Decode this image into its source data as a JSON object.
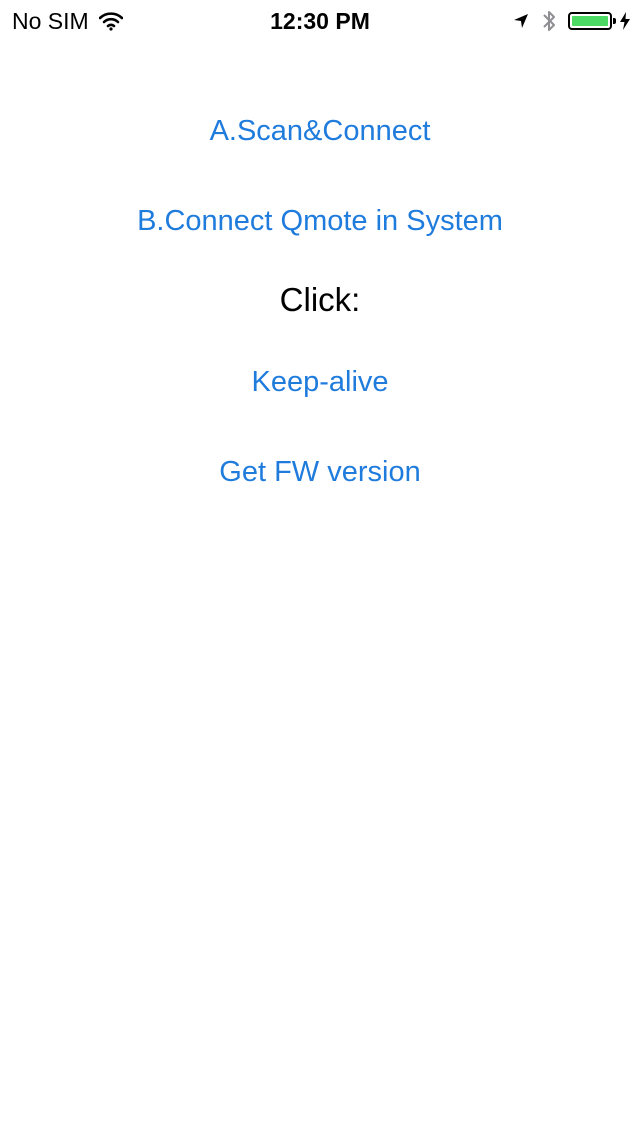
{
  "status_bar": {
    "carrier": "No SIM",
    "time": "12:30 PM",
    "battery_level": 1.0,
    "battery_color": "#4cd964",
    "icons": [
      "wifi-icon",
      "location-icon",
      "bluetooth-icon",
      "battery-icon",
      "charging-icon"
    ]
  },
  "main": {
    "scan_connect_label": "A.Scan&Connect",
    "connect_system_label": "B.Connect Qmote in System",
    "click_label": "Click:",
    "keep_alive_label": "Keep-alive",
    "fw_version_label": "Get FW version"
  },
  "colors": {
    "accent": "#1f7cdd",
    "text": "#000000",
    "background": "#ffffff"
  }
}
